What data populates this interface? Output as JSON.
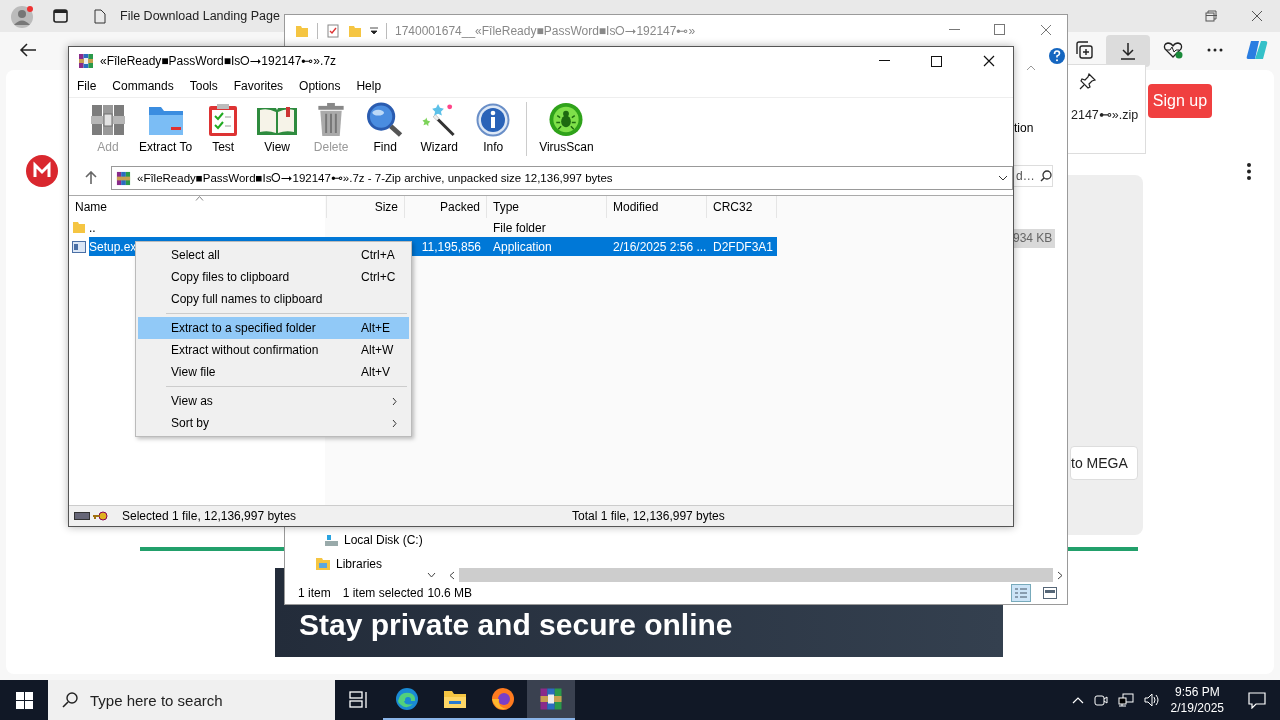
{
  "browser": {
    "tabs": [
      {
        "label": "File Download Landing Page",
        "selected": false
      }
    ],
    "sign_up": "Sign up",
    "download_file": "2147⊷».zip",
    "save_button": "to MEGA",
    "banner": "Stay private and secure online"
  },
  "explorer": {
    "title": "1740001674__«FîleReady■PassWord■Is⭘➞192147⊷»",
    "ribbon_label": "tion",
    "search": {
      "placeholder": "d…"
    },
    "size_cell": "934 KB",
    "nav": [
      {
        "label": "Local Disk (C:)",
        "kind": "drive"
      },
      {
        "label": "Libraries",
        "kind": "folder"
      }
    ],
    "status": {
      "count": "1 item",
      "selection": "1 item selected",
      "size": "10.6 MB"
    }
  },
  "archiver": {
    "title": "«FîleReady■PassWord■Is⭘➞192147⊷».7z",
    "menu": [
      "File",
      "Commands",
      "Tools",
      "Favorites",
      "Options",
      "Help"
    ],
    "toolbar": [
      {
        "label": "Add",
        "kind": "add",
        "disabled": true
      },
      {
        "label": "Extract To",
        "kind": "extract",
        "disabled": false
      },
      {
        "label": "Test",
        "kind": "test",
        "disabled": false
      },
      {
        "label": "View",
        "kind": "view",
        "disabled": false
      },
      {
        "label": "Delete",
        "kind": "delete",
        "disabled": true
      },
      {
        "label": "Find",
        "kind": "find",
        "disabled": false
      },
      {
        "label": "Wizard",
        "kind": "wizard",
        "disabled": false
      },
      {
        "label": "Info",
        "kind": "info",
        "disabled": false
      },
      {
        "label": "VirusScan",
        "kind": "virusscan",
        "disabled": false
      }
    ],
    "path": "«FîleReady■PassWord■Is⭘➞192147⊷».7z - 7-Zip archive, unpacked size 12,136,997 bytes",
    "columns": [
      "Name",
      "Size",
      "Packed",
      "Type",
      "Modified",
      "CRC32"
    ],
    "rows": [
      {
        "kind": "folder",
        "name": "..",
        "type": "File folder",
        "selected": false
      },
      {
        "kind": "file",
        "name": "Setup.ex",
        "packed": "11,195,856",
        "type": "Application",
        "modified": "2/16/2025 2:56 ...",
        "crc32": "D2FDF3A1",
        "selected": true
      }
    ],
    "status": {
      "selected": "Selected 1 file, 12,136,997 bytes",
      "total": "Total 1 file, 12,136,997 bytes"
    }
  },
  "context_menu": [
    {
      "kind": "item",
      "label": "Select all",
      "shortcut": "Ctrl+A",
      "selected": false
    },
    {
      "kind": "item",
      "label": "Copy files to clipboard",
      "shortcut": "Ctrl+C",
      "selected": false
    },
    {
      "kind": "item",
      "label": "Copy full names to clipboard",
      "selected": false
    },
    {
      "kind": "separator"
    },
    {
      "kind": "item",
      "label": "Extract to a specified folder",
      "shortcut": "Alt+E",
      "selected": true
    },
    {
      "kind": "item",
      "label": "Extract without confirmation",
      "shortcut": "Alt+W",
      "selected": false
    },
    {
      "kind": "item",
      "label": "View file",
      "shortcut": "Alt+V",
      "selected": false
    },
    {
      "kind": "separator"
    },
    {
      "kind": "submenu",
      "label": "View as",
      "selected": false
    },
    {
      "kind": "submenu",
      "label": "Sort by",
      "selected": false
    }
  ],
  "taskbar": {
    "search": {
      "placeholder": "Type here to search"
    },
    "apps": [
      {
        "kind": "edge",
        "selected": false
      },
      {
        "kind": "explorer",
        "selected": false
      },
      {
        "kind": "firefox",
        "selected": false
      },
      {
        "kind": "archiver",
        "selected": true
      }
    ],
    "time": "9:56 PM",
    "date": "2/19/2025"
  }
}
